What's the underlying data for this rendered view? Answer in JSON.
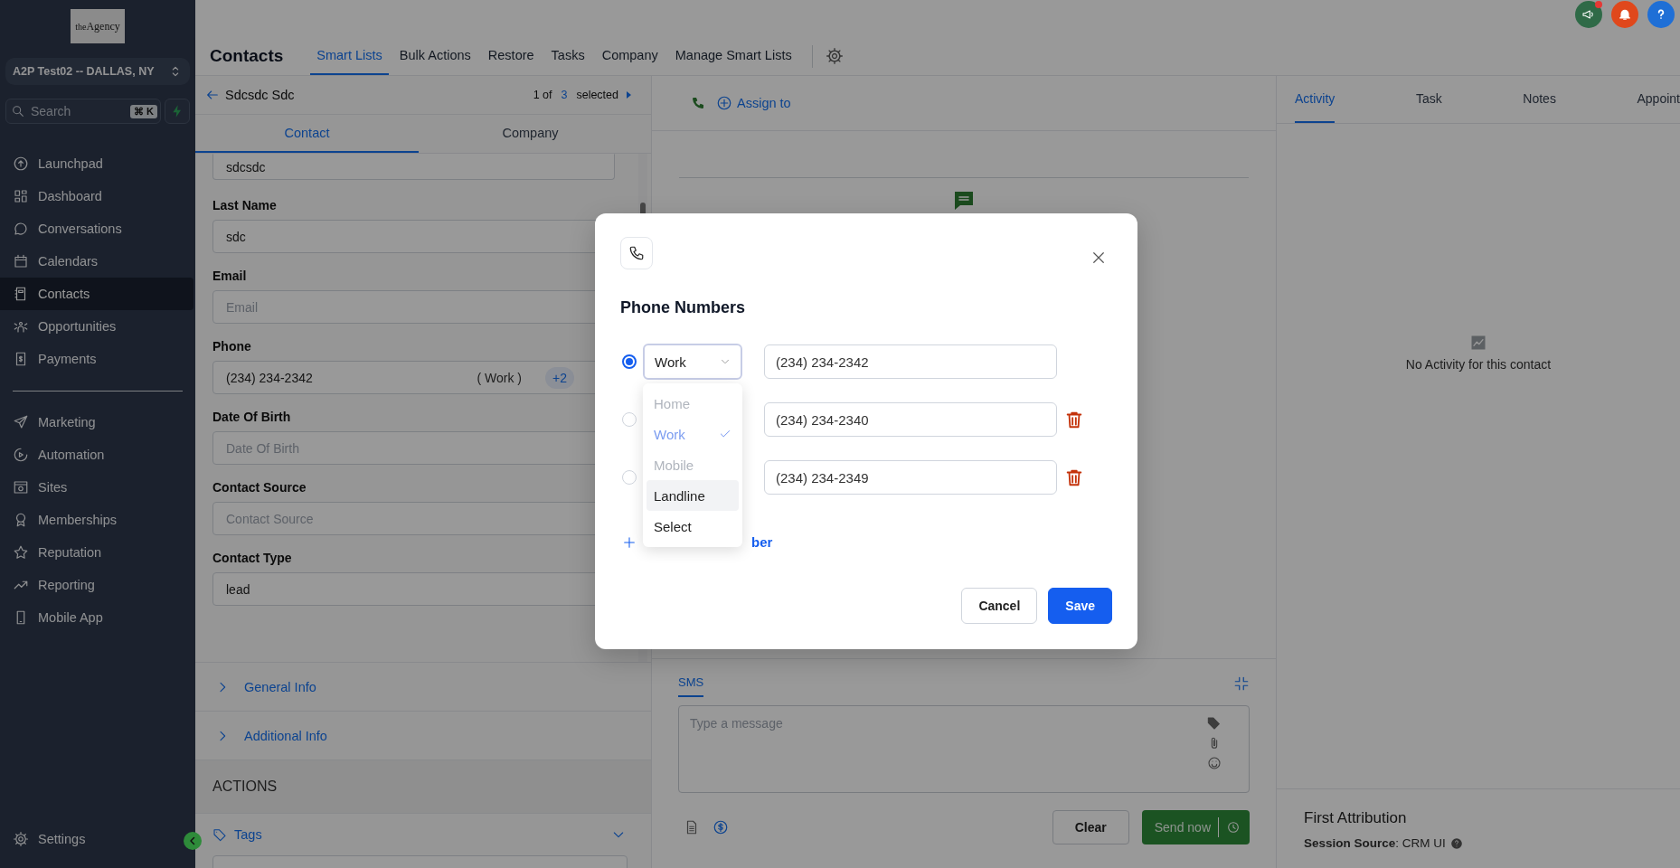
{
  "sidebar": {
    "logo": "$^{the}$Agency",
    "location": "A2P Test02 -- DALLAS, NY",
    "search": {
      "placeholder": "Search",
      "shortcut": "⌘ K"
    },
    "nav_primary": [
      {
        "label": "Launchpad",
        "selected": false
      },
      {
        "label": "Dashboard",
        "selected": false
      },
      {
        "label": "Conversations",
        "selected": false
      },
      {
        "label": "Calendars",
        "selected": false
      },
      {
        "label": "Contacts",
        "selected": true
      },
      {
        "label": "Opportunities",
        "selected": false
      },
      {
        "label": "Payments",
        "selected": false
      }
    ],
    "nav_secondary": [
      {
        "label": "Marketing",
        "selected": false
      },
      {
        "label": "Automation",
        "selected": false
      },
      {
        "label": "Sites",
        "selected": false
      },
      {
        "label": "Memberships",
        "selected": false
      },
      {
        "label": "Reputation",
        "selected": false
      },
      {
        "label": "Reporting",
        "selected": false
      },
      {
        "label": "Mobile App",
        "selected": false
      }
    ],
    "settings": "Settings"
  },
  "header": {
    "title": "Contacts",
    "tabs": [
      {
        "label": "Smart Lists",
        "selected": true
      },
      {
        "label": "Bulk Actions",
        "selected": false
      },
      {
        "label": "Restore",
        "selected": false
      },
      {
        "label": "Tasks",
        "selected": false
      },
      {
        "label": "Company",
        "selected": false
      },
      {
        "label": "Manage Smart Lists",
        "selected": false
      }
    ]
  },
  "contact_panel": {
    "name": "Sdcsdc Sdc",
    "pager": {
      "position": "1 of",
      "count": "3",
      "suffix": "selected"
    },
    "tabs": [
      {
        "label": "Contact",
        "selected": true
      },
      {
        "label": "Company",
        "selected": false
      }
    ],
    "fields": [
      {
        "value": "sdcsdc"
      },
      {
        "label": "Last Name",
        "value": "sdc"
      },
      {
        "label": "Email",
        "placeholder": "Email"
      },
      {
        "label": "Phone",
        "value": "(234) 234-2342",
        "type_label": "( Work )",
        "extra": "+2"
      },
      {
        "label": "Date Of Birth",
        "placeholder": "Date Of Birth"
      },
      {
        "label": "Contact Source",
        "placeholder": "Contact Source"
      },
      {
        "label": "Contact Type",
        "value": "lead"
      }
    ],
    "sections": [
      {
        "label": "General Info",
        "expanded": false
      },
      {
        "label": "Additional Info",
        "expanded": false
      }
    ],
    "actions_heading": "ACTIONS",
    "tags": {
      "label": "Tags"
    }
  },
  "conversation": {
    "assign": "Assign to",
    "composer": {
      "tabs": [
        {
          "label": "SMS",
          "selected": true
        }
      ],
      "placeholder": "Type a message",
      "clear": "Clear",
      "send": "Send now"
    }
  },
  "activity": {
    "tabs": [
      {
        "label": "Activity",
        "selected": true
      },
      {
        "label": "Task",
        "selected": false
      },
      {
        "label": "Notes",
        "selected": false
      },
      {
        "label": "Appoint",
        "selected": false
      }
    ],
    "empty": "No Activity for this contact",
    "attribution": {
      "title": "First Attribution",
      "source": "**Session Source**: CRM UI"
    }
  },
  "modal": {
    "title": "Phone Numbers",
    "phones": [
      {
        "selected": true,
        "type": "Work",
        "number": "(234) 234-2342",
        "deletable": false
      },
      {
        "selected": false,
        "number": "(234) 234-2340",
        "deletable": true
      },
      {
        "selected": false,
        "number": "(234) 234-2349",
        "deletable": true
      }
    ],
    "type_menu": [
      {
        "label": "Home",
        "selected": false,
        "disabled": true,
        "highlighted": false
      },
      {
        "label": "Work",
        "selected": true,
        "disabled": true,
        "highlighted": false
      },
      {
        "label": "Mobile",
        "selected": false,
        "disabled": true,
        "highlighted": false
      },
      {
        "label": "Landline",
        "selected": false,
        "disabled": false,
        "highlighted": true
      },
      {
        "label": "Select",
        "selected": false,
        "disabled": false,
        "highlighted": false
      }
    ],
    "add_link": "ber",
    "buttons": [
      {
        "label": "Cancel",
        "kind": "secondary"
      },
      {
        "label": "Save",
        "kind": "primary"
      }
    ]
  }
}
